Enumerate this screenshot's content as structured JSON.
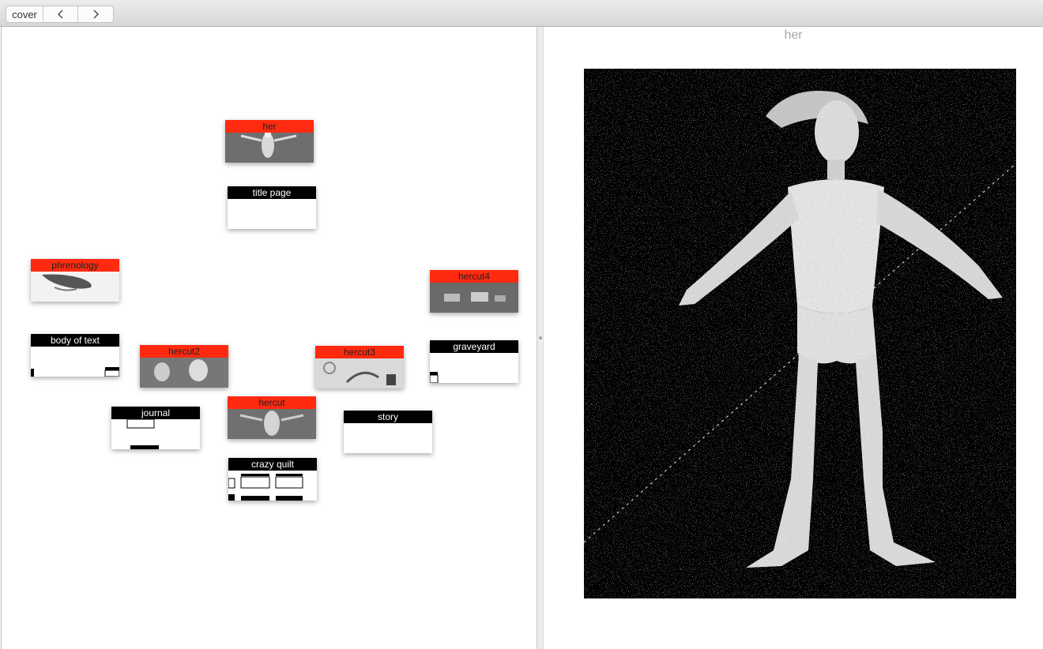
{
  "toolbar": {
    "cover_label": "cover",
    "back_icon": "chevron-left-icon",
    "forward_icon": "chevron-right-icon"
  },
  "map": {
    "cards": [
      {
        "id": "her",
        "title": "her",
        "style": "red"
      },
      {
        "id": "title-page",
        "title": "title page",
        "style": "black"
      },
      {
        "id": "phrenology",
        "title": "phrenology",
        "style": "red"
      },
      {
        "id": "hercut4",
        "title": "hercut4",
        "style": "red"
      },
      {
        "id": "body-of-text",
        "title": "body of text",
        "style": "black"
      },
      {
        "id": "hercut2",
        "title": "hercut2",
        "style": "red"
      },
      {
        "id": "hercut3",
        "title": "hercut3",
        "style": "red"
      },
      {
        "id": "graveyard",
        "title": "graveyard",
        "style": "black"
      },
      {
        "id": "hercut",
        "title": "hercut",
        "style": "red"
      },
      {
        "id": "journal",
        "title": "journal",
        "style": "black"
      },
      {
        "id": "story",
        "title": "story",
        "style": "black"
      },
      {
        "id": "crazy-quilt",
        "title": "crazy quilt",
        "style": "black"
      }
    ]
  },
  "viewer": {
    "title": "her"
  },
  "colors": {
    "accent_red": "#ff2a10",
    "card_black": "#000000",
    "title_gray": "#a7a7a7"
  }
}
